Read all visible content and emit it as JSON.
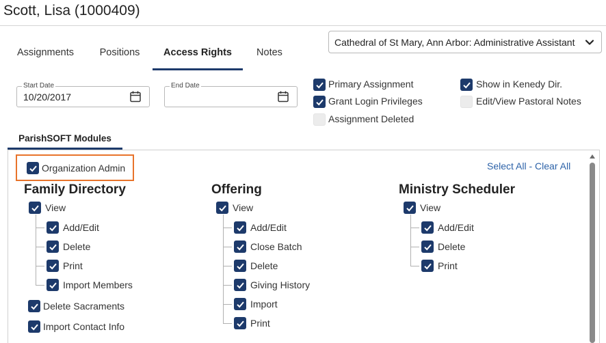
{
  "header": {
    "title": "Scott, Lisa (1000409)"
  },
  "tabs": [
    {
      "label": "Assignments"
    },
    {
      "label": "Positions"
    },
    {
      "label": "Access Rights"
    },
    {
      "label": "Notes"
    }
  ],
  "assignment_select": {
    "value": "Cathedral of St Mary, Ann Arbor: Administrative Assistant"
  },
  "start_date": {
    "label": "Start Date",
    "value": "10/20/2017"
  },
  "end_date": {
    "label": "End Date",
    "value": ""
  },
  "options": {
    "primary_assignment": {
      "label": "Primary Assignment",
      "checked": true
    },
    "grant_login": {
      "label": "Grant Login Privileges",
      "checked": true
    },
    "assignment_deleted": {
      "label": "Assignment Deleted",
      "checked": false
    },
    "show_in_dir": {
      "label": "Show in Kenedy Dir.",
      "checked": true
    },
    "edit_pastoral_notes": {
      "label": "Edit/View Pastoral Notes",
      "checked": false
    }
  },
  "modules_tab": {
    "label": "ParishSOFT Modules"
  },
  "org_admin": {
    "label": "Organization Admin",
    "checked": true
  },
  "select_all": "Select All",
  "separator": "-",
  "clear_all": "Clear All",
  "family_directory": {
    "title": "Family Directory",
    "view": "View",
    "children": [
      "Add/Edit",
      "Delete",
      "Print",
      "Import Members"
    ],
    "delete_sacraments": "Delete Sacraments",
    "import_contact_info": "Import Contact Info"
  },
  "offering": {
    "title": "Offering",
    "view": "View",
    "children": [
      "Add/Edit",
      "Close Batch",
      "Delete",
      "Giving History",
      "Import",
      "Print"
    ]
  },
  "ministry_scheduler": {
    "title": "Ministry Scheduler",
    "view": "View",
    "children": [
      "Add/Edit",
      "Delete",
      "Print"
    ]
  },
  "colors": {
    "accent": "#1d3a6b",
    "highlight": "#e8732a",
    "link": "#2c62a8"
  }
}
